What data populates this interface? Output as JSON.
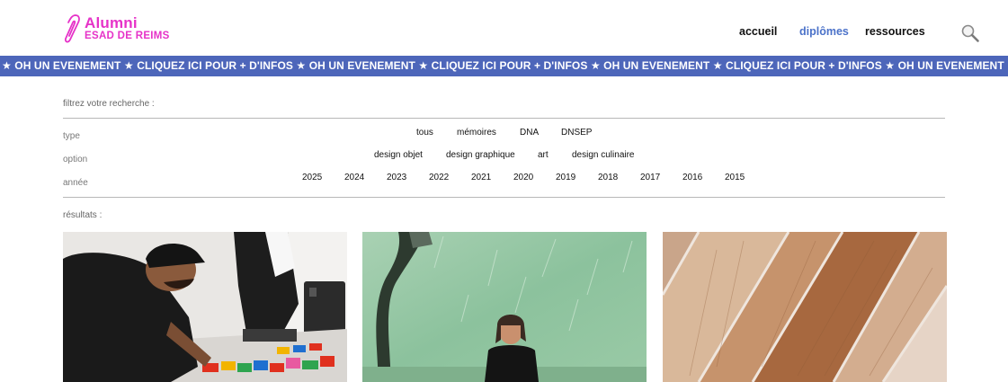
{
  "header": {
    "logo_title": "Alumni",
    "logo_subtitle": "ESAD DE REIMS",
    "logo_icon": "paperclip-logo",
    "brand_color": "#e632c8",
    "nav": [
      {
        "label": "accueil",
        "active": false
      },
      {
        "label": "diplômes",
        "active": true
      },
      {
        "label": "ressources",
        "active": false
      }
    ],
    "nav_active_color": "#4b72c9",
    "search_icon": "search-icon"
  },
  "banner": {
    "text": "★ OH UN EVENEMENT ★ CLIQUEZ ICI POUR + D'INFOS ★ OH UN EVENEMENT ★ CLIQUEZ ICI POUR + D'INFOS ★ OH UN EVENEMENT ★ CLIQUEZ ICI POUR + D'INFOS ★ OH UN EVENEMENT ★ CLIQUEZ ICI POUR + D'INFOS ★ OH UN EVENEMENT ★ CLI",
    "background": "#4d66ba"
  },
  "filters": {
    "title": "filtrez votre recherche :",
    "type": {
      "label": "type",
      "options": [
        "tous",
        "mémoires",
        "DNA",
        "DNSEP"
      ]
    },
    "option": {
      "label": "option",
      "options": [
        "design objet",
        "design graphique",
        "art",
        "design culinaire"
      ]
    },
    "year": {
      "label": "année",
      "options": [
        "2025",
        "2024",
        "2023",
        "2022",
        "2021",
        "2020",
        "2019",
        "2018",
        "2017",
        "2016",
        "2015"
      ]
    }
  },
  "results": {
    "title": "résultats :",
    "cards": [
      {
        "image": "person-arranging-colorful-objects-photo"
      },
      {
        "image": "child-with-sculpture-green-background-photo"
      },
      {
        "image": "wood-panels-photo"
      }
    ]
  }
}
